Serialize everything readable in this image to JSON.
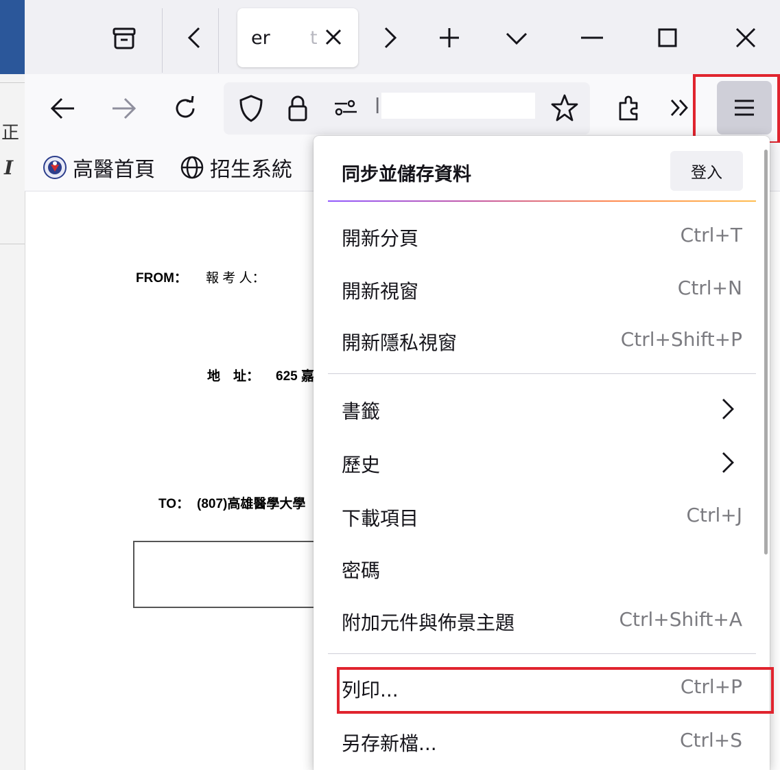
{
  "window": {
    "tab_title": "er",
    "tab_title_fade": "t"
  },
  "navbar": {
    "url_visible_text": "l ·  ,"
  },
  "bookmarks": [
    {
      "label": "高醫首頁",
      "icon": "kmu-logo-icon"
    },
    {
      "label": "招生系統",
      "icon": "globe-icon"
    }
  ],
  "page": {
    "from_label": "FROM：",
    "applicant_label": "報 考 人：",
    "address_label": "地　址：",
    "address_value": "625 嘉",
    "to_label": "TO：",
    "to_value": "(807)高雄醫學大學",
    "left_glyph1": "正",
    "left_glyph2": "I"
  },
  "menu": {
    "sync_title": "同步並儲存資料",
    "signin_label": "登入",
    "items": [
      {
        "label": "開新分頁",
        "shortcut": "Ctrl+T"
      },
      {
        "label": "開新視窗",
        "shortcut": "Ctrl+N"
      },
      {
        "label": "開新隱私視窗",
        "shortcut": "Ctrl+Shift+P"
      },
      {
        "label": "書籤",
        "shortcut": ""
      },
      {
        "label": "歷史",
        "shortcut": ""
      },
      {
        "label": "下載項目",
        "shortcut": "Ctrl+J"
      },
      {
        "label": "密碼",
        "shortcut": ""
      },
      {
        "label": "附加元件與佈景主題",
        "shortcut": "Ctrl+Shift+A"
      },
      {
        "label": "列印...",
        "shortcut": "Ctrl+P"
      },
      {
        "label": "另存新檔...",
        "shortcut": "Ctrl+S"
      }
    ]
  },
  "colors": {
    "highlight": "#e0242e",
    "chrome_bg": "#f0f0f4",
    "menu_button_bg": "#cfcfd8"
  }
}
